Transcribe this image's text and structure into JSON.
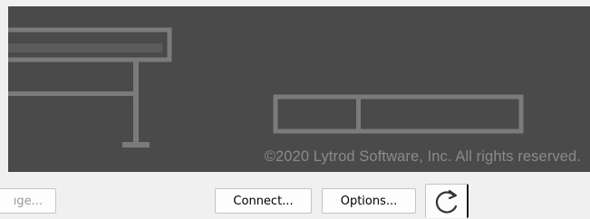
{
  "banner": {
    "copyright": "©2020 Lytrod Software, Inc. All rights reserved.",
    "background_color": "#4a4a4a",
    "graphic_color": "#7b7b7b"
  },
  "buttons": {
    "image_label": "ıge...",
    "connect_label": "Connect...",
    "options_label": "Options...",
    "refresh_icon": "refresh-icon"
  }
}
